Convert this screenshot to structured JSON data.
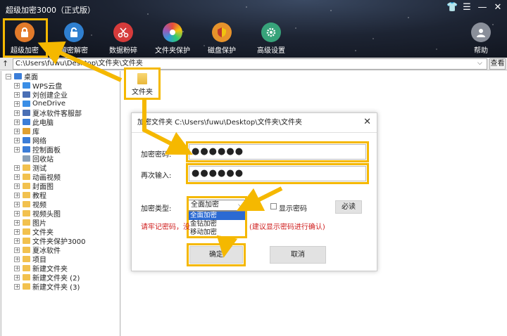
{
  "window": {
    "title": "超级加密3000（正式版）",
    "controls": [
      "shirt-icon",
      "menu-icon",
      "minimize-icon",
      "close-icon"
    ]
  },
  "toolbar": {
    "items": [
      {
        "label": "超级加密",
        "icon": "lock-icon",
        "color": "#e27a2a"
      },
      {
        "label": "解密解密",
        "icon": "unlock-icon",
        "color": "#2f7fcf"
      },
      {
        "label": "数据粉碎",
        "icon": "scissors-icon",
        "color": "#d63b3b"
      },
      {
        "label": "文件夹保护",
        "icon": "ring-icon",
        "color": "#e7a24a"
      },
      {
        "label": "磁盘保护",
        "icon": "shield-icon",
        "color": "#e7932b"
      },
      {
        "label": "高级设置",
        "icon": "gear-icon",
        "color": "#37a37a"
      },
      {
        "label": "帮助",
        "icon": "user-icon",
        "color": "#8a8f9a"
      }
    ]
  },
  "pathbar": {
    "up": "↑",
    "path": "C:\\Users\\fuwu\\Desktop\\文件夹\\文件夹",
    "view_label": "查看"
  },
  "tree": {
    "root": "桌面",
    "items": [
      {
        "label": "WPS云盘",
        "icon": "cloud-icon"
      },
      {
        "label": "刘创建企业",
        "icon": "contact-icon"
      },
      {
        "label": "OneDrive",
        "icon": "cloud-icon"
      },
      {
        "label": "夏冰软件客服部",
        "icon": "contact-icon"
      },
      {
        "label": "此电脑",
        "icon": "computer-icon"
      },
      {
        "label": "库",
        "icon": "library-icon"
      },
      {
        "label": "网络",
        "icon": "network-icon"
      },
      {
        "label": "控制面板",
        "icon": "control-panel-icon"
      },
      {
        "label": "回收站",
        "icon": "recycle-bin-icon"
      },
      {
        "label": "测试",
        "icon": "folder-icon"
      },
      {
        "label": "动画视频",
        "icon": "folder-icon"
      },
      {
        "label": "封面图",
        "icon": "folder-icon"
      },
      {
        "label": "教程",
        "icon": "folder-icon"
      },
      {
        "label": "视频",
        "icon": "folder-icon"
      },
      {
        "label": "视频头图",
        "icon": "folder-icon"
      },
      {
        "label": "图片",
        "icon": "folder-icon"
      },
      {
        "label": "文件夹",
        "icon": "folder-icon"
      },
      {
        "label": "文件夹保护3000",
        "icon": "folder-icon"
      },
      {
        "label": "夏冰软件",
        "icon": "folder-icon"
      },
      {
        "label": "项目",
        "icon": "folder-icon"
      },
      {
        "label": "新建文件夹",
        "icon": "folder-icon"
      },
      {
        "label": "新建文件夹 (2)",
        "icon": "folder-icon"
      },
      {
        "label": "新建文件夹 (3)",
        "icon": "folder-icon"
      }
    ]
  },
  "main": {
    "folder_label": "文件夹"
  },
  "dialog": {
    "title": "加密文件夹 C:\\Users\\fuwu\\Desktop\\文件夹\\文件夹",
    "close": "✕",
    "pwd_label": "加密密码:",
    "pwd_value": "●●●●●●",
    "confirm_label": "再次输入:",
    "confirm_value": "●●●●●●",
    "type_label": "加密类型:",
    "type_selected": "全面加密",
    "type_options": [
      "全面加密",
      "金钻加密",
      "移动加密"
    ],
    "show_pwd_label": "显示密码",
    "fetch_btn": "必读",
    "warn_left": "请牢记密码，没",
    "warn_right": "(建议显示密码进行确认)",
    "ok_btn": "确定",
    "cancel_btn": "取消"
  },
  "colors": {
    "highlight": "#f5b800",
    "selected_option": "#2b6ad3",
    "warning": "#d02020"
  }
}
